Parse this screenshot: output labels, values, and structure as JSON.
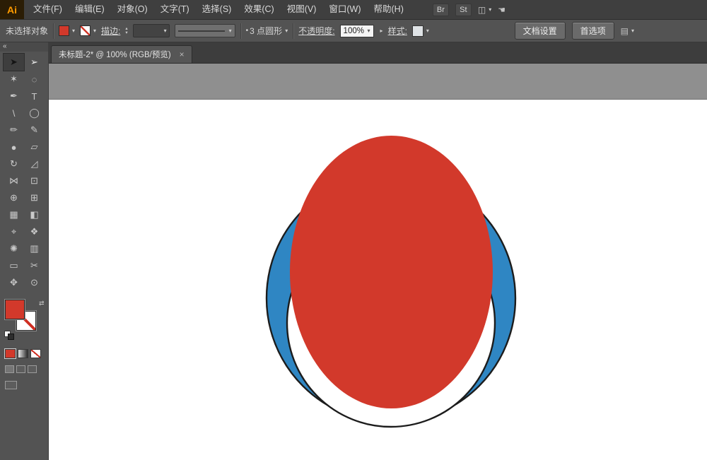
{
  "app": {
    "logo": "Ai"
  },
  "menubar": {
    "items": [
      {
        "name": "menu-file",
        "label": "文件(F)"
      },
      {
        "name": "menu-edit",
        "label": "编辑(E)"
      },
      {
        "name": "menu-object",
        "label": "对象(O)"
      },
      {
        "name": "menu-type",
        "label": "文字(T)"
      },
      {
        "name": "menu-select",
        "label": "选择(S)"
      },
      {
        "name": "menu-effect",
        "label": "效果(C)"
      },
      {
        "name": "menu-view",
        "label": "视图(V)"
      },
      {
        "name": "menu-window",
        "label": "窗口(W)"
      },
      {
        "name": "menu-help",
        "label": "帮助(H)"
      }
    ],
    "right": {
      "br": "Br",
      "st": "St"
    }
  },
  "control_bar": {
    "no_selection": "未选择对象",
    "stroke_label": "描边:",
    "brush_value": "3 点圆形",
    "opacity_label": "不透明度:",
    "opacity_value": "100%",
    "style_label": "样式:",
    "doc_setup_button": "文档设置",
    "preferences_button": "首选项"
  },
  "document_tab": {
    "title": "未标题-2* @ 100% (RGB/预览)",
    "close_label": "×"
  },
  "toolbar": {
    "collapse_label": "«",
    "tools": [
      {
        "name": "selection-tool",
        "glyph": "➤"
      },
      {
        "name": "direct-selection-tool",
        "glyph": "➢"
      },
      {
        "name": "magic-wand-tool",
        "glyph": "✶"
      },
      {
        "name": "lasso-tool",
        "glyph": "◌"
      },
      {
        "name": "pen-tool",
        "glyph": "✒"
      },
      {
        "name": "type-tool",
        "glyph": "T"
      },
      {
        "name": "line-segment-tool",
        "glyph": "\\"
      },
      {
        "name": "ellipse-tool",
        "glyph": "◯"
      },
      {
        "name": "paintbrush-tool",
        "glyph": "✏"
      },
      {
        "name": "pencil-tool",
        "glyph": "✎"
      },
      {
        "name": "blob-brush-tool",
        "glyph": "●"
      },
      {
        "name": "eraser-tool",
        "glyph": "▱"
      },
      {
        "name": "rotate-tool",
        "glyph": "↻"
      },
      {
        "name": "scale-tool",
        "glyph": "◿"
      },
      {
        "name": "width-tool",
        "glyph": "⋈"
      },
      {
        "name": "free-transform-tool",
        "glyph": "⊡"
      },
      {
        "name": "shape-builder-tool",
        "glyph": "⊕"
      },
      {
        "name": "perspective-grid-tool",
        "glyph": "⊞"
      },
      {
        "name": "mesh-tool",
        "glyph": "▦"
      },
      {
        "name": "gradient-tool",
        "glyph": "◧"
      },
      {
        "name": "eyedropper-tool",
        "glyph": "⌖"
      },
      {
        "name": "blend-tool",
        "glyph": "❖"
      },
      {
        "name": "symbol-sprayer-tool",
        "glyph": "✺"
      },
      {
        "name": "column-graph-tool",
        "glyph": "▥"
      },
      {
        "name": "artboard-tool",
        "glyph": "▭"
      },
      {
        "name": "slice-tool",
        "glyph": "✂"
      },
      {
        "name": "hand-tool",
        "glyph": "✥"
      },
      {
        "name": "zoom-tool",
        "glyph": "⊙"
      }
    ]
  },
  "icons": {
    "chevron": "▾",
    "stepper_up": "▴",
    "stepper_down": "▾",
    "swap": "⇄",
    "panel_menu": "▤",
    "arrange": "◫",
    "hand": "☚",
    "expand": "▸",
    "brush_dot": "•"
  },
  "artwork": {
    "red": "#d2392b",
    "blue": "#2f86c3",
    "white": "#ffffff",
    "outline": "#1c1c1c"
  },
  "colors": {
    "fill_swatch": "#d2392b",
    "logo_orange": "#ff9b00",
    "panel_gray": "#535353",
    "canvas_gray": "#8f8f8f"
  }
}
